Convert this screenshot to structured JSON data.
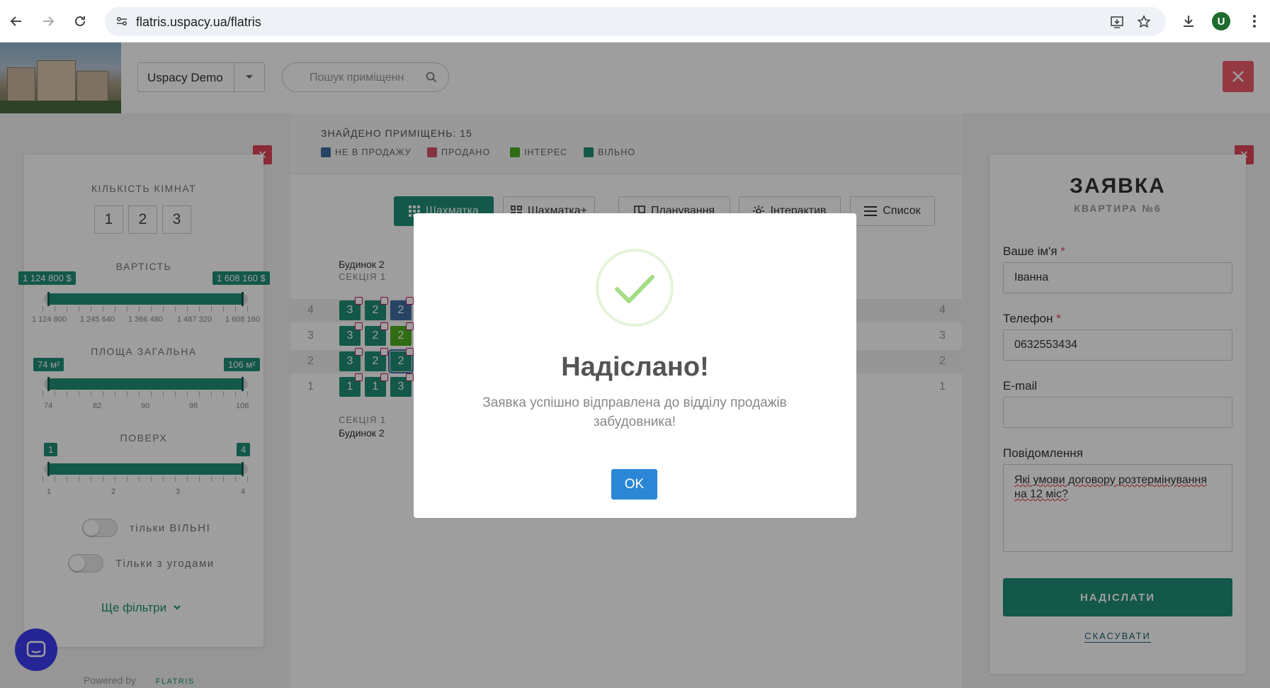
{
  "browser": {
    "url": "flatris.uspacy.ua/flatris",
    "avatar_letter": "U"
  },
  "header": {
    "project": "Uspacy Demo",
    "search_placeholder": "Пошук приміщенн"
  },
  "filters": {
    "rooms_label": "КІЛЬКІСТЬ КІМНАТ",
    "rooms": [
      "1",
      "2",
      "3"
    ],
    "price_label": "ВАРТІСТЬ",
    "price_min": "1 124 800 $",
    "price_max": "1 608 160 $",
    "price_scale": [
      "1 124 800",
      "1 245 640",
      "1 366 480",
      "1 487 320",
      "1 608 160"
    ],
    "area_label": "ПЛОЩА ЗАГАЛЬНА",
    "area_min": "74 м²",
    "area_max": "106 м²",
    "area_scale": [
      "74",
      "82",
      "90",
      "98",
      "106"
    ],
    "floor_label": "ПОВЕРХ",
    "floor_min": "1",
    "floor_max": "4",
    "floor_scale": [
      "1",
      "2",
      "3",
      "4"
    ],
    "toggle_free": "тільки ВІЛЬНІ",
    "toggle_deals": "Тільки з угодами",
    "more_filters": "Ще фільтри"
  },
  "center": {
    "found": "ЗНАЙДЕНО ПРИМІЩЕНЬ: 15",
    "legend": [
      {
        "label": "НЕ В ПРОДАЖУ",
        "color": "#3f6fa3"
      },
      {
        "label": "ПРОДАНО",
        "color": "#d9536b"
      },
      {
        "label": "ІНТЕРЕС",
        "color": "#4caf1f"
      },
      {
        "label": "ВІЛЬНО",
        "color": "#1f8e76"
      }
    ],
    "tabs": [
      "Шахматка",
      "Шахматка+",
      "Планування",
      "Інтерактив",
      "Список"
    ],
    "building_top": "Будинок 2",
    "section_top": "СЕКЦІЯ 1",
    "section_bottom": "СЕКЦІЯ 1",
    "building_bottom": "Будинок 2",
    "floors": [
      {
        "num": "4",
        "cells": [
          {
            "v": "3",
            "c": "#1f8e76"
          },
          {
            "v": "2",
            "c": "#1f8e76"
          },
          {
            "v": "2",
            "c": "#3f6fa3"
          }
        ]
      },
      {
        "num": "3",
        "cells": [
          {
            "v": "3",
            "c": "#1f8e76"
          },
          {
            "v": "2",
            "c": "#1f8e76"
          },
          {
            "v": "2",
            "c": "#4caf1f"
          }
        ]
      },
      {
        "num": "2",
        "cells": [
          {
            "v": "3",
            "c": "#1f8e76"
          },
          {
            "v": "2",
            "c": "#1f8e76"
          },
          {
            "v": "2",
            "c": "#1f8e76"
          }
        ]
      },
      {
        "num": "1",
        "cells": [
          {
            "v": "1",
            "c": "#1f8e76"
          },
          {
            "v": "1",
            "c": "#1f8e76"
          },
          {
            "v": "3",
            "c": "#1f8e76"
          }
        ]
      }
    ]
  },
  "form": {
    "title": "ЗАЯВКА",
    "subtitle": "КВАРТИРА №6",
    "name_label": "Ваше ім'я",
    "name_value": "Іванна",
    "phone_label": "Телефон",
    "phone_value": "0632553434",
    "email_label": "E-mail",
    "email_value": "",
    "message_label": "Повідомлення",
    "message_value": "Які умови договору розтермінування на 12 міс?",
    "required_mark": "*",
    "submit": "НАДІСЛАТИ",
    "cancel": "СКАСУВАТИ"
  },
  "footer": {
    "powered": "Powered by",
    "brand": "FLATRIS"
  },
  "modal": {
    "title": "Надіслано!",
    "text": "Заявка успішно відправлена до відділу продажів забудовника!",
    "ok": "OK"
  }
}
